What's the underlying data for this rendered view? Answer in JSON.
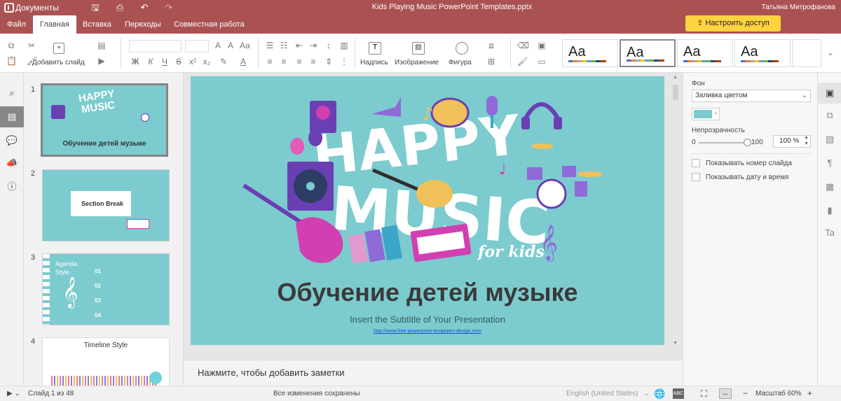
{
  "titlebar": {
    "app_name": "Документы",
    "doc_title": "Kids Playing Music PowerPoint Templates.pptx",
    "user": "Татьяна Митрофанова"
  },
  "tabs": [
    {
      "label": "Файл"
    },
    {
      "label": "Главная"
    },
    {
      "label": "Вставка"
    },
    {
      "label": "Переходы"
    },
    {
      "label": "Совместная работа"
    }
  ],
  "share_label": "Настроить доступ",
  "toolbar": {
    "add_slide": "Добавить слайд",
    "caption": "Надпись",
    "image": "Изображение",
    "shape": "Фигура",
    "theme_sample": "Aa"
  },
  "slides": [
    {
      "num": "1",
      "title": "Обучение детей музыке"
    },
    {
      "num": "2",
      "title": "Section Break"
    },
    {
      "num": "3",
      "title": "Agenda Style"
    },
    {
      "num": "4",
      "title": "Timeline Style"
    }
  ],
  "agenda_items": [
    "01",
    "02",
    "03",
    "04"
  ],
  "thumb_words": {
    "happy": "HAPPY",
    "music": "MUSIC",
    "for_kids": "for kids"
  },
  "current_slide": {
    "title": "Обучение детей музыке",
    "subtitle": "Insert the Subtitle of Your Presentation",
    "url": "http://www.free-powerpoint-templates-design.com"
  },
  "notes_placeholder": "Нажмите, чтобы добавить заметки",
  "right_panel": {
    "bg_label": "Фон",
    "fill_type": "Заливка цветом",
    "fill_color": "#7ccbcf",
    "opacity_label": "Непрозрачность",
    "opacity_min": "0",
    "opacity_max": "100",
    "opacity_value": "100 %",
    "show_slide_number": "Показывать номер слайда",
    "show_date_time": "Показывать дату и время"
  },
  "status": {
    "slide_of": "Слайд 1 из 48",
    "saved": "Все изменения сохранены",
    "language": "English (United States)",
    "zoom": "Масштаб 60%"
  },
  "colors": {
    "brand": "#aa5252",
    "share": "#ffd23f",
    "slide_bg": "#7ccbcf"
  }
}
